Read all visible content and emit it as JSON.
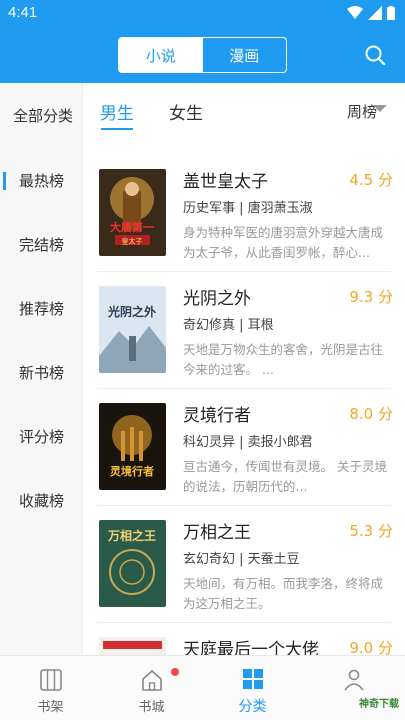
{
  "status": {
    "time": "4:41"
  },
  "header": {
    "tabs": [
      {
        "label": "小说",
        "active": true
      },
      {
        "label": "漫画",
        "active": false
      }
    ],
    "accent": "#1f9cf0"
  },
  "sidebar": {
    "all_label": "全部分类",
    "items": [
      {
        "label": "最热榜",
        "active": true
      },
      {
        "label": "完结榜"
      },
      {
        "label": "推荐榜"
      },
      {
        "label": "新书榜"
      },
      {
        "label": "评分榜"
      },
      {
        "label": "收藏榜"
      }
    ]
  },
  "filter": {
    "gender_tabs": [
      {
        "label": "男生",
        "active": true
      },
      {
        "label": "女生"
      }
    ],
    "period": "周榜"
  },
  "books": [
    {
      "title": "盖世皇太子",
      "score": "4.5 分",
      "genre": "历史军事",
      "author": "唐羽萧玉淑",
      "desc": "身为特种军医的唐羽意外穿越大唐成为太子爷，从此香闺罗帐，醉心...",
      "cover_text": "大唐第一皇太子"
    },
    {
      "title": "光阴之外",
      "score": "9.3 分",
      "genre": "奇幻修真",
      "author": "耳根",
      "desc": "天地是万物众生的客舍，光阴是古往今来的过客。 ...",
      "cover_text": "光阴之外"
    },
    {
      "title": "灵境行者",
      "score": "8.0 分",
      "genre": "科幻灵异",
      "author": "卖报小郎君",
      "desc": "亘古通今，传闻世有灵境。 关于灵境的说法，历朝历代的...",
      "cover_text": "灵境行者"
    },
    {
      "title": "万相之王",
      "score": "5.3 分",
      "genre": "玄幻奇幻",
      "author": "天蚕土豆",
      "desc": "天地间，有万相。而我李洛，终将成为这万相之王。",
      "cover_text": "万相之王"
    },
    {
      "title": "天庭最后一个大佬",
      "score": "9.0 分",
      "genre": "",
      "author": "",
      "desc": "",
      "cover_text": "天庭最后一个大佬"
    }
  ],
  "bottom_nav": [
    {
      "label": "书架",
      "icon": "bookshelf-icon"
    },
    {
      "label": "书城",
      "icon": "home-icon",
      "badge": true
    },
    {
      "label": "分类",
      "icon": "category-icon",
      "active": true
    },
    {
      "label": "我的",
      "icon": "profile-icon"
    }
  ],
  "watermark": "神奇下载"
}
